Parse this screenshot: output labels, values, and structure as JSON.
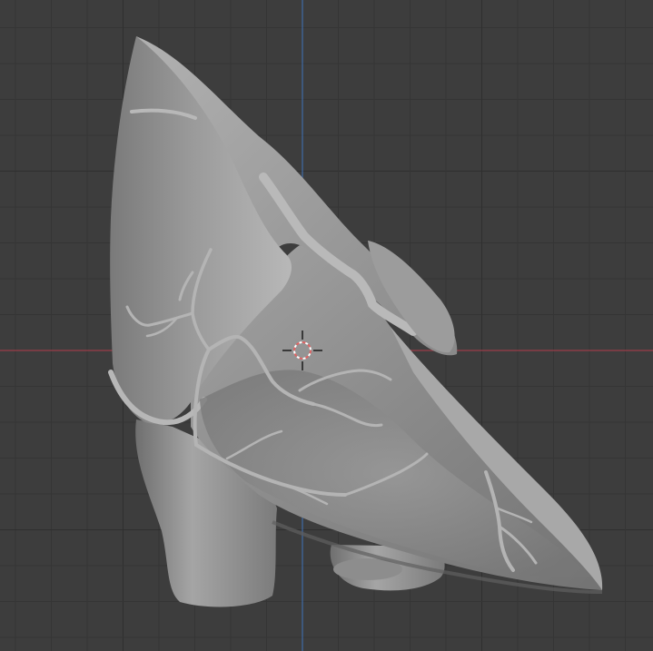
{
  "viewport": {
    "background_color": "#3d3d3d",
    "grid_color": "#353535",
    "grid_major_color": "#2f2f2f",
    "x_axis_color": "#9b3d49",
    "y_axis_color": "#3f6aa6",
    "model_color": "#8f8f8f",
    "model_shadow_color": "#626262",
    "model_highlight_color": "#b7b7b7",
    "vessel_color": "#a9a9a9",
    "cursor_color": "#e06464",
    "model_name": "heart-mesh",
    "cursor_name": "3d-cursor"
  }
}
